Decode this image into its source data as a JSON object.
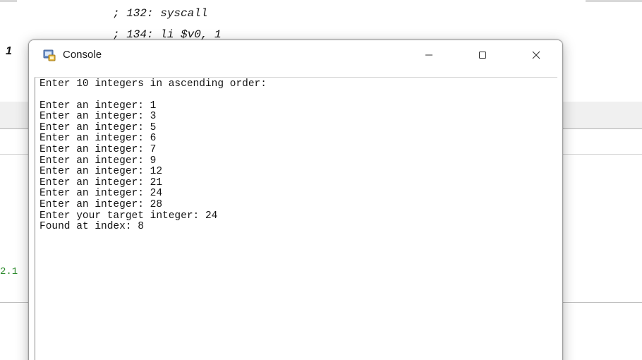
{
  "background_editor": {
    "code_lines": [
      "; 132: syscall",
      "; 134: li $v0, 1"
    ],
    "line_number": "1",
    "green_text": "2.1"
  },
  "console": {
    "title": "Console",
    "window_controls": {
      "minimize_icon": "minimize-icon",
      "maximize_icon": "maximize-icon",
      "close_icon": "close-icon"
    },
    "output": [
      "Enter 10 integers in ascending order:",
      "Enter an integer: 1",
      "Enter an integer: 3",
      "Enter an integer: 5",
      "Enter an integer: 6",
      "Enter an integer: 7",
      "Enter an integer: 9",
      "Enter an integer: 12",
      "Enter an integer: 21",
      "Enter an integer: 24",
      "Enter an integer: 28",
      "Enter your target integer: 24",
      "Found at index: 8"
    ]
  }
}
